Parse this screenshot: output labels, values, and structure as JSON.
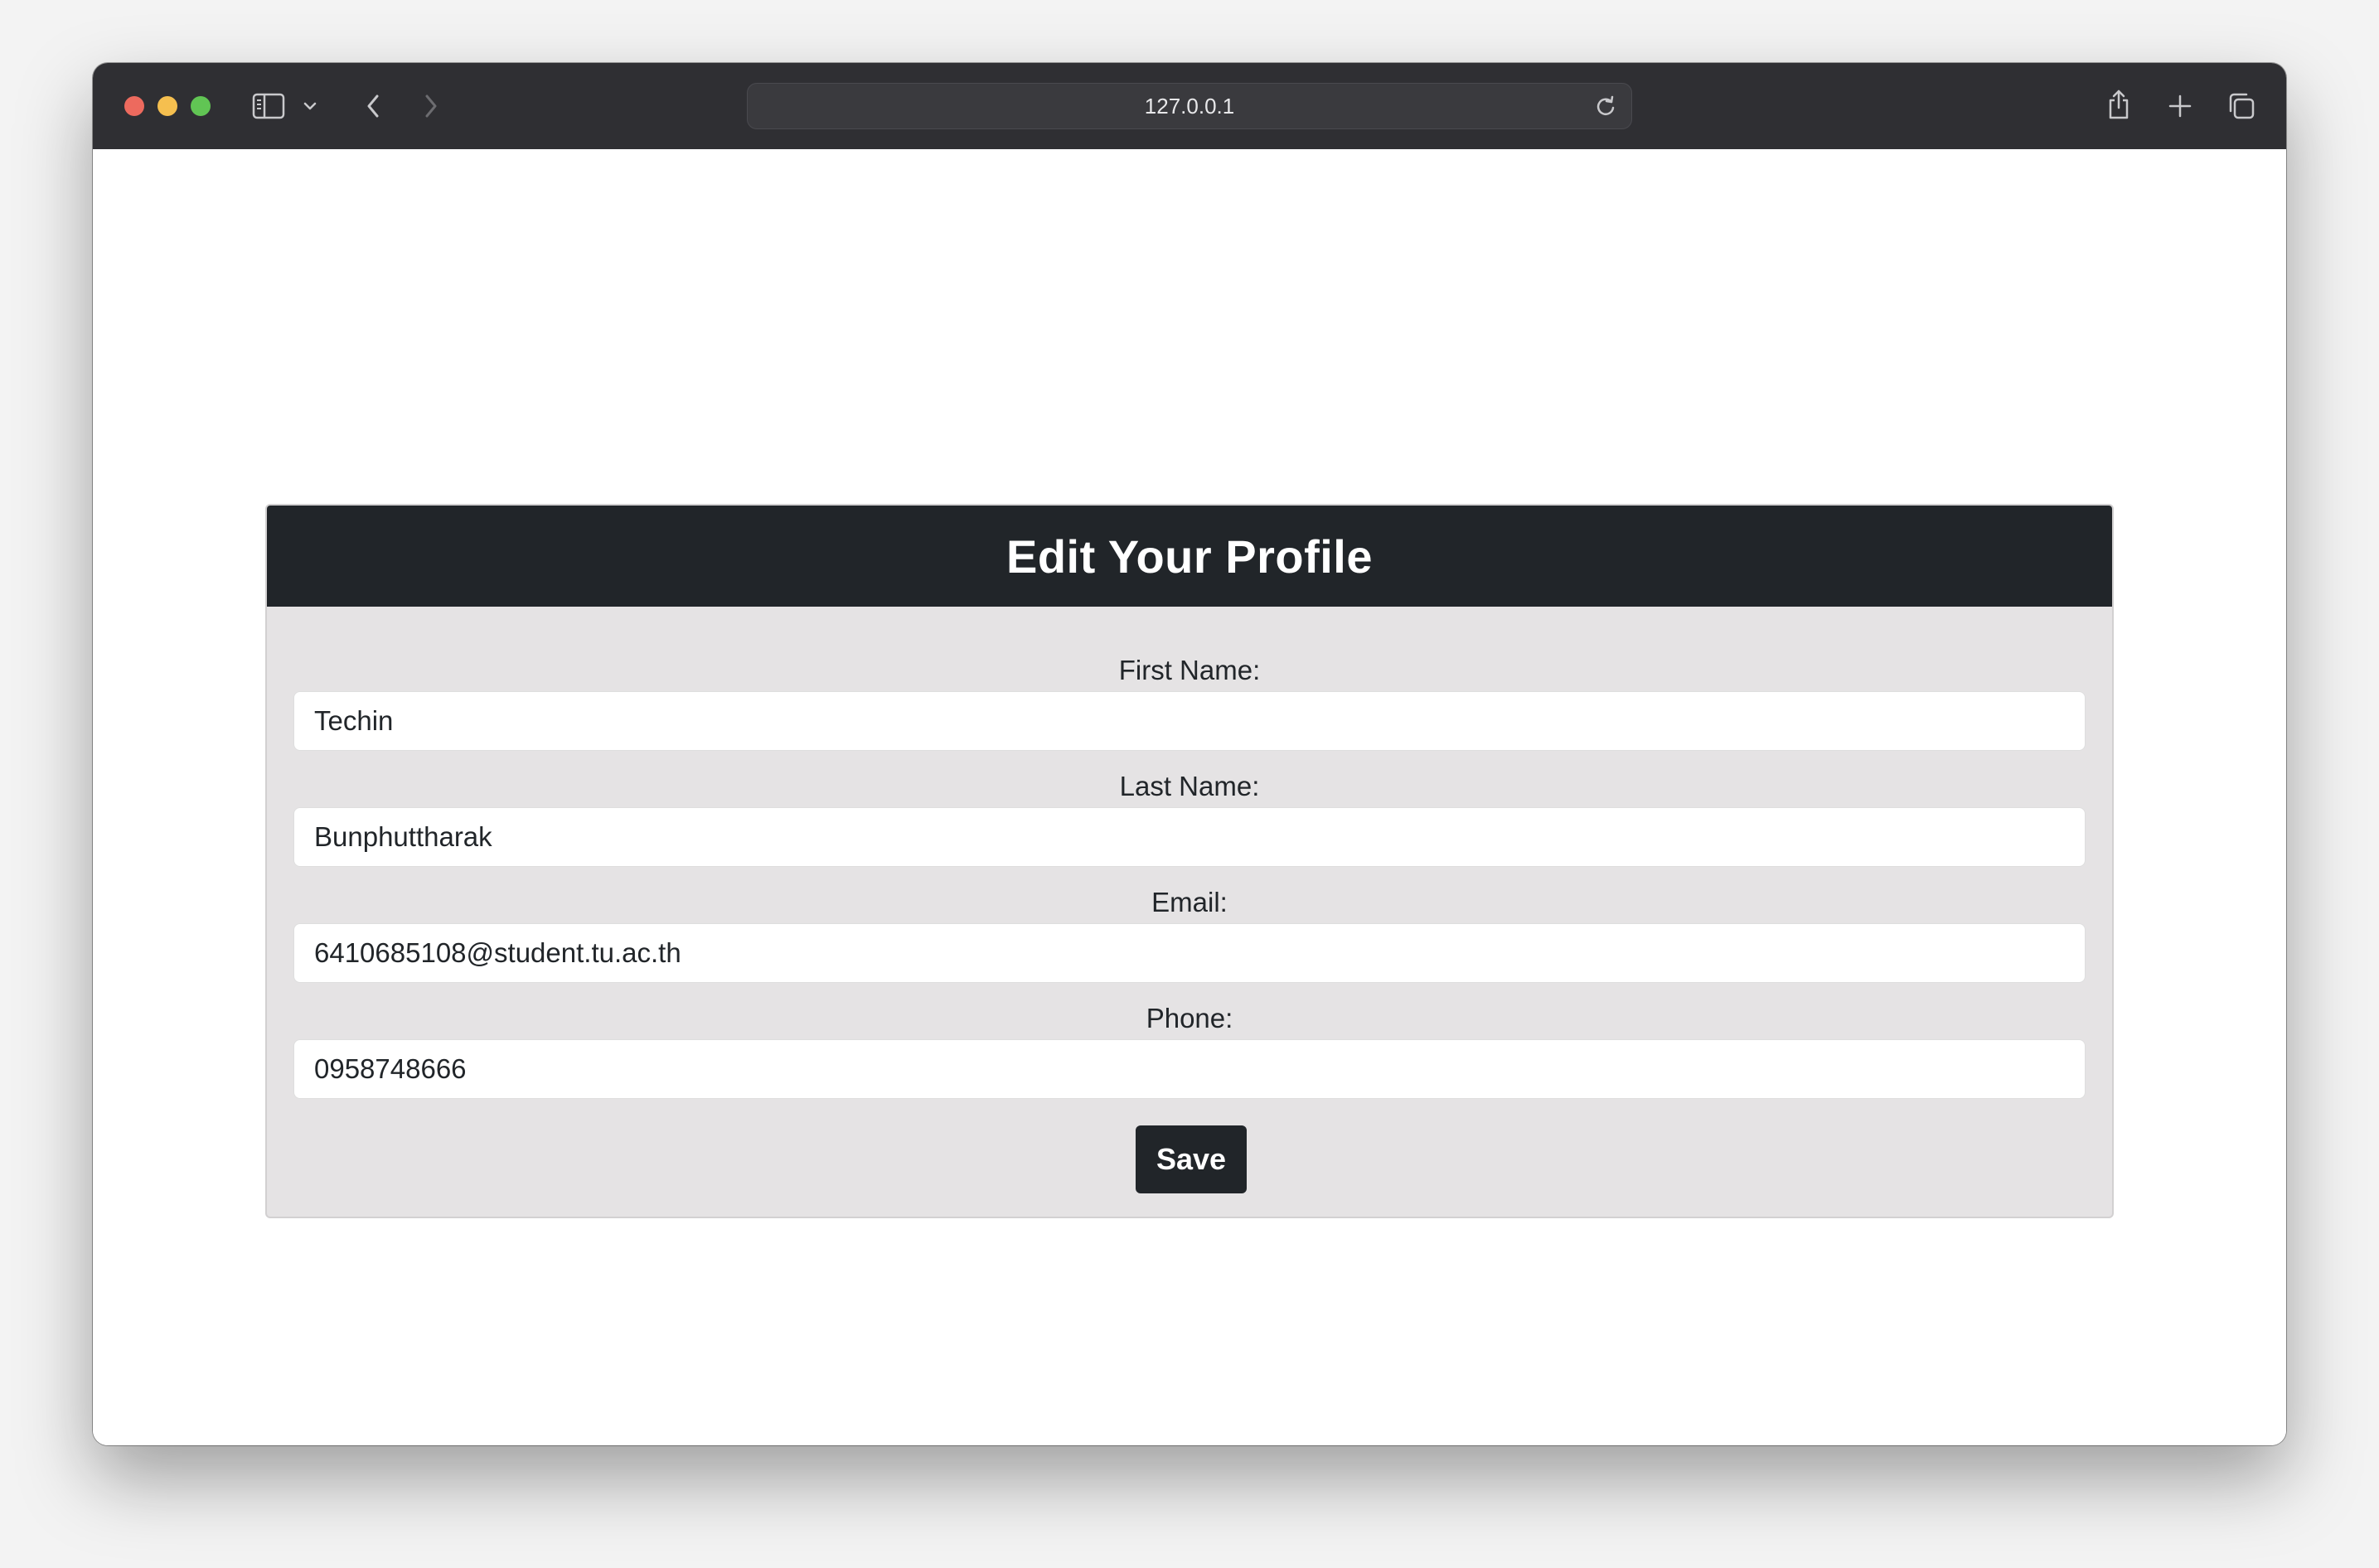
{
  "browser": {
    "url": "127.0.0.1",
    "icons": {
      "sidebar": "sidebar-icon",
      "sidebar_menu": "chevron-down-icon",
      "back": "chevron-left-icon",
      "forward": "chevron-right-icon",
      "reload": "reload-icon",
      "share": "share-icon",
      "new_tab": "plus-icon",
      "tab_overview": "tabs-icon"
    },
    "colors": {
      "close": "#ed6a5e",
      "minimize": "#f5bf4f",
      "maximize": "#61c554",
      "titlebar": "#2f2f33"
    }
  },
  "form": {
    "title": "Edit Your Profile",
    "fields": [
      {
        "label": "First Name:",
        "value": "Techin"
      },
      {
        "label": "Last Name:",
        "value": "Bunphuttharak"
      },
      {
        "label": "Email:",
        "value": "6410685108@student.tu.ac.th"
      },
      {
        "label": "Phone:",
        "value": "0958748666"
      }
    ],
    "save_label": "Save",
    "colors": {
      "header": "#212529",
      "card": "#e5e3e4",
      "button": "#212529"
    }
  }
}
